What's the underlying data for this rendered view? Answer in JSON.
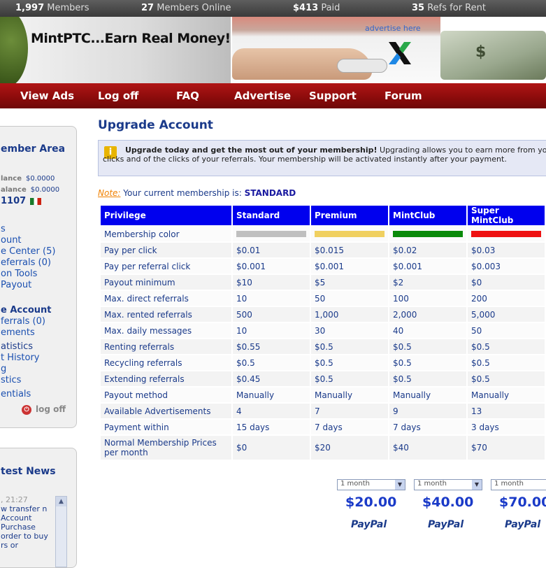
{
  "topbar": {
    "members_count": "1,997",
    "members_label": "Members",
    "online_count": "27",
    "online_label": "Members Online",
    "paid_amount": "$413",
    "paid_label": "Paid",
    "refs_count": "35",
    "refs_label": "Refs for Rent"
  },
  "header": {
    "logo_text": "MintPTC...Earn Real Money!",
    "advertise_label": "advertise here",
    "money_symbol": "$"
  },
  "nav": [
    "View Ads",
    "Log off",
    "FAQ",
    "Advertise",
    "Support",
    "Forum"
  ],
  "sidebar": {
    "title": "ember Area",
    "balance1_label": "lance",
    "balance1_value": "$0.0000",
    "balance2_label": "alance",
    "balance2_value": "$0.0000",
    "user_id": "1107",
    "links": [
      {
        "label": "s",
        "count": ""
      },
      {
        "label": "ount",
        "count": ""
      },
      {
        "label": "e Center",
        "count": "(5)"
      },
      {
        "label": "eferrals",
        "count": "(0)"
      },
      {
        "label": "on Tools",
        "count": ""
      },
      {
        "label": " Payout",
        "count": ""
      },
      {
        "label": "e Account",
        "count": ""
      },
      {
        "label": "ferrals",
        "count": "(0)"
      },
      {
        "label": "ements",
        "count": ""
      },
      {
        "label": "atistics",
        "count": ""
      },
      {
        "label": "t History",
        "count": ""
      },
      {
        "label": "g",
        "count": ""
      },
      {
        "label": "stics",
        "count": ""
      },
      {
        "label": "entials",
        "count": ""
      }
    ],
    "logoff_label": "log off"
  },
  "news": {
    "title": "test News",
    "date": ", 21:27",
    "text": "w transfer n Account Purchase order to buy rs or"
  },
  "main": {
    "title": "Upgrade Account",
    "notice_bold": "Upgrade today and get the most out of your membership!",
    "notice_text": " Upgrading allows you to earn more from your clicks and of the clicks of your referrals. Your membership will be activated instantly after your payment.",
    "note_label": "Note:",
    "membership_text": "Your current membership is:",
    "membership_level": "STANDARD"
  },
  "table": {
    "headers": [
      "Privilege",
      "Standard",
      "Premium",
      "MintClub",
      "Super MintClub"
    ],
    "color_row_label": "Membership color",
    "membership_colors": [
      "#bfbfbf",
      "#f0d060",
      "#0a8a0a",
      "#ee1111"
    ],
    "rows": [
      [
        "Pay per click",
        "$0.01",
        "$0.015",
        "$0.02",
        "$0.03"
      ],
      [
        "Pay per referral click",
        "$0.001",
        "$0.001",
        "$0.001",
        "$0.003"
      ],
      [
        "Payout minimum",
        "$10",
        "$5",
        "$2",
        "$0"
      ],
      [
        "Max. direct referrals",
        "10",
        "50",
        "100",
        "200"
      ],
      [
        "Max. rented referrals",
        "500",
        "1,000",
        "2,000",
        "5,000"
      ],
      [
        "Max. daily messages",
        "10",
        "30",
        "40",
        "50"
      ],
      [
        "Renting referrals",
        "$0.55",
        "$0.5",
        "$0.5",
        "$0.5"
      ],
      [
        "Recycling referrals",
        "$0.5",
        "$0.5",
        "$0.5",
        "$0.5"
      ],
      [
        "Extending referrals",
        "$0.45",
        "$0.5",
        "$0.5",
        "$0.5"
      ],
      [
        "Payout method",
        "Manually",
        "Manually",
        "Manually",
        "Manually"
      ],
      [
        "Available Advertisements",
        "4",
        "7",
        "9",
        "13"
      ],
      [
        "Payment within",
        "15 days",
        "7 days",
        "7 days",
        "3 days"
      ],
      [
        "Normal Membership Prices per month",
        "$0",
        "$20",
        "$40",
        "$70"
      ]
    ]
  },
  "plans": [
    {
      "duration": "1 month",
      "price": "$20.00",
      "paypal_label": "PayPal"
    },
    {
      "duration": "1 month",
      "price": "$40.00",
      "paypal_label": "PayPal"
    },
    {
      "duration": "1 month",
      "price": "$70.00",
      "paypal_label": "PayPal"
    }
  ]
}
